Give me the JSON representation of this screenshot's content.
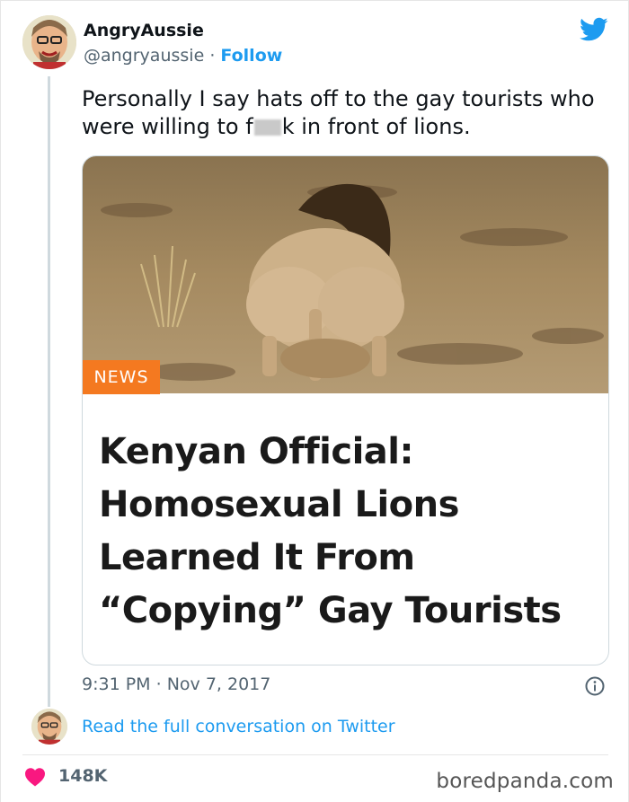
{
  "tweet": {
    "author_name": "AngryAussie",
    "handle": "@angryaussie",
    "separator": "·",
    "follow_label": "Follow",
    "text_part1": "Personally I say hats off to the gay tourists who were willing to f",
    "text_part2": "k in front of lions.",
    "time": "9:31 PM",
    "date": "Nov 7, 2017",
    "likes": "148K",
    "read_more": "Read the full conversation on Twitter"
  },
  "article": {
    "badge": "NEWS",
    "headline_lines": [
      "Kenyan Official:",
      "Homosexual Lions",
      "Learned It From",
      "“Copying” Gay Tourists"
    ]
  },
  "icons": {
    "brand": "twitter-bird-icon",
    "info": "info-icon",
    "like": "heart-icon"
  },
  "colors": {
    "link": "#1d9bf0",
    "muted": "#536471",
    "badge": "#f47920",
    "heart": "#f91880"
  },
  "watermark": "boredpanda.com"
}
